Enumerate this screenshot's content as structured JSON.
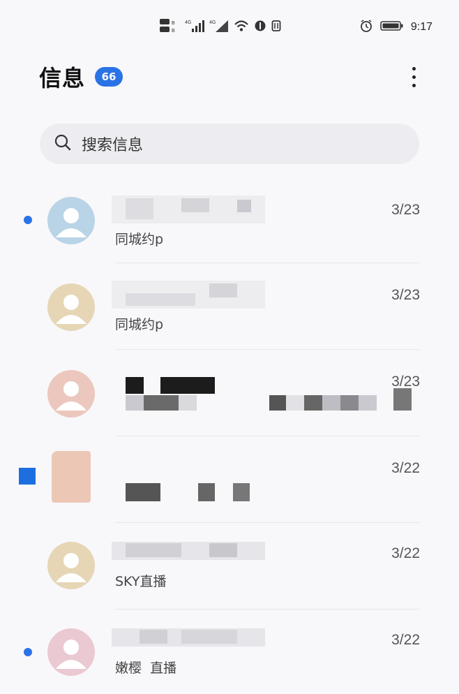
{
  "status_bar": {
    "time": "9:17",
    "icons": [
      "sim-hd-icon",
      "signal-4g-icon",
      "signal-4g-icon",
      "wifi-icon",
      "data-saver-icon",
      "nfc-icon",
      "alarm-icon",
      "battery-icon"
    ]
  },
  "header": {
    "title": "信息",
    "unread_badge": "66",
    "more_icon": "more-vertical-icon"
  },
  "search": {
    "icon": "search-icon",
    "placeholder": "搜索信息"
  },
  "conversations": [
    {
      "sender": "",
      "preview": "同城约p",
      "date": "3/23",
      "unread": true,
      "avatar": "default-avatar-blue"
    },
    {
      "sender": "",
      "preview": "同城约p",
      "date": "3/23",
      "unread": false,
      "avatar": "default-avatar-tan"
    },
    {
      "sender": "",
      "preview": "",
      "date": "3/23",
      "unread": false,
      "avatar": "default-avatar-pink"
    },
    {
      "sender": "",
      "preview": "",
      "date": "3/22",
      "unread": true,
      "avatar": "photo-avatar"
    },
    {
      "sender": "",
      "preview": "SKY直播",
      "date": "3/22",
      "unread": false,
      "avatar": "default-avatar-tan"
    },
    {
      "sender": "",
      "preview": "嫩樱  直播",
      "date": "3/22",
      "unread": true,
      "avatar": "default-avatar-rose"
    }
  ],
  "colors": {
    "accent": "#2a73e6",
    "avatar_blue": "#b9d4e6",
    "avatar_tan": "#e6d6b6",
    "avatar_pink": "#ecc7bd",
    "avatar_rose": "#ebc9d2"
  }
}
